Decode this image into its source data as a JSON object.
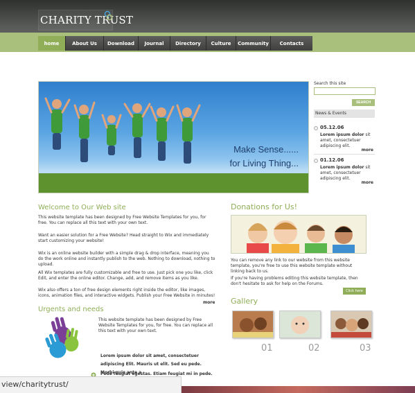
{
  "header": {
    "logo_text": "CHARITY TRUST"
  },
  "nav": {
    "items": [
      "home",
      "About Us",
      "Download",
      "Journal",
      "Directory",
      "Culture",
      "Community",
      "Contacts"
    ]
  },
  "hero": {
    "line1": "Make Sense......",
    "line2": "for Living Thing..."
  },
  "sidebar": {
    "search_label": "Search this site",
    "search_button": "SEARCH",
    "news_heading": "News & Events",
    "news": [
      {
        "date": "05.12.06",
        "bold": "Lorem ipsum dolor",
        "text": "sit amet, consectetuer adipiscing elit.",
        "more": "more"
      },
      {
        "date": "01.12.06",
        "bold": "Lorem ipsum dolor",
        "text": "sit amet, consectetuer adipiscing elit.",
        "more": "more"
      }
    ]
  },
  "welcome": {
    "title": "Welcome to Our Web site",
    "p1": "This website template has been designed by Free Website Templates for you, for free. You can replace all this text with your own text.",
    "p2": "Want an easier solution for a Free Website? Head straight to Wix and immediately start customizing your website!",
    "p3": "Wix is an online website builder with a simple drag & drop interface, meaning you do the work online and instantly publish to the web. Nothing to download, nothing to upload.",
    "p4": "All Wix templates are fully customizable and free to use. Just pick one you like, click Edit, and enter the online editor. Change, add, and remove items as you like.",
    "p5": "Wix also offers a ton of free design elements right inside the editor, like images, icons, animation files, and interactive widgets. Publish your Free Website in minutes!",
    "more": "more"
  },
  "urgents": {
    "title": "Urgents and needs",
    "p1": "This website template has been designed by Free Website Templates for you, for free. You can replace all this text with your own text.",
    "p2": "Lorem ipsum dolor sit amet, consectetuer adipiscing Elit. Mauris ut elit. Sed eu pede. Morbi quis ante a",
    "p3": "Pede feugiat egestas. Etiam feugiat mi in pede."
  },
  "donations": {
    "title": "Donations for Us!",
    "p1": "You can remove any link to our website from this website template, you're free to use this website template without linking back to us.",
    "p2": "If you're having problems editing this website template, then don't hesitate to ask for help on the Forums.",
    "button": "Click here"
  },
  "gallery": {
    "title": "Gallery",
    "numbers": [
      "01",
      "02",
      "03"
    ]
  },
  "status_bar": {
    "url": "view/charitytrust/"
  },
  "colors": {
    "accent_green": "#8fae57",
    "nav_band": "#a9c07c",
    "header_dark": "#3f403e"
  }
}
